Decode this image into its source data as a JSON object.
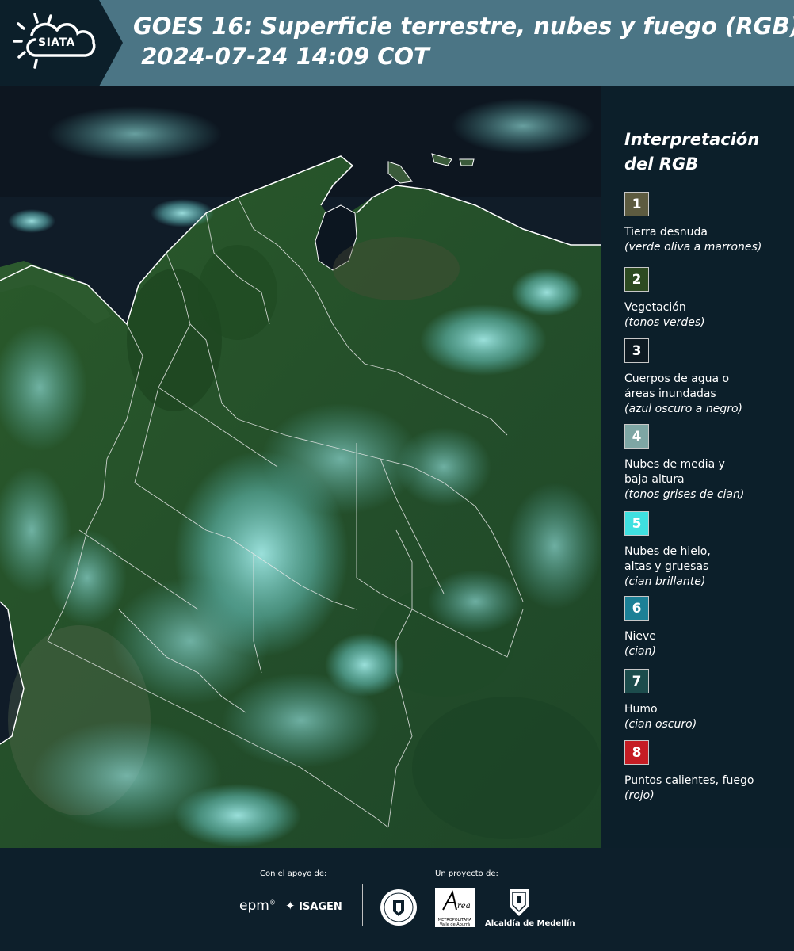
{
  "header": {
    "logo_text": "SIATA",
    "title_line1": "GOES 16: Superficie terrestre, nubes y fuego (RGB)",
    "title_line2": " 2024-07-24 14:09 COT"
  },
  "legend": {
    "title_line1": "Interpretación",
    "title_line2": "del RGB",
    "items": [
      {
        "num": "1",
        "color": "#5d5b40",
        "label": "Tierra desnuda",
        "sub": "(verde oliva a marrones)"
      },
      {
        "num": "2",
        "color": "#2d4a21",
        "label": "Vegetación",
        "sub": "(tonos verdes)"
      },
      {
        "num": "3",
        "color": "#0e1a22",
        "label": "Cuerpos de agua o áreas inundadas",
        "sub": "(azul oscuro a negro)"
      },
      {
        "num": "4",
        "color": "#7ea6a4",
        "label": "Nubes de media y baja altura",
        "sub": "(tonos grises de cian)"
      },
      {
        "num": "5",
        "color": "#3fe0e0",
        "label": "Nubes de hielo, altas y gruesas",
        "sub": "(cian brillante)"
      },
      {
        "num": "6",
        "color": "#1c8096",
        "label": "Nieve",
        "sub": "(cian)"
      },
      {
        "num": "7",
        "color": "#1c4c4c",
        "label": "Humo",
        "sub": "(cian oscuro)"
      },
      {
        "num": "8",
        "color": "#c61d24",
        "label": "Puntos calientes, fuego",
        "sub": "(rojo)"
      }
    ]
  },
  "footer": {
    "support_label": "Con el apoyo de:",
    "project_label": "Un proyecto de:",
    "epm": "epm",
    "isagen": "ISAGEN",
    "metro_line1": "METROPOLITANA",
    "metro_line2": "Valle de Aburrá",
    "alcaldia": "Alcaldía de Medellín"
  }
}
